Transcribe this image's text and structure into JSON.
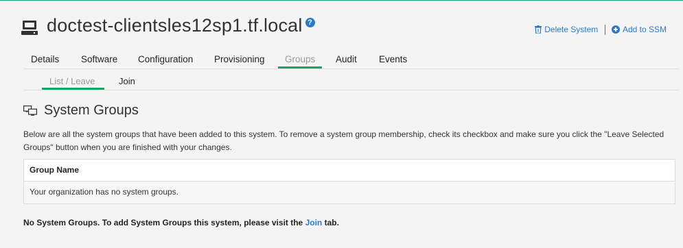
{
  "system": {
    "title": "doctest-clientsles12sp1.tf.local",
    "help_icon": "?"
  },
  "actions": {
    "delete_label": "Delete System",
    "add_ssm_label": "Add to SSM"
  },
  "tabs": [
    {
      "label": "Details",
      "active": false
    },
    {
      "label": "Software",
      "active": false
    },
    {
      "label": "Configuration",
      "active": false
    },
    {
      "label": "Provisioning",
      "active": false
    },
    {
      "label": "Groups",
      "active": true
    },
    {
      "label": "Audit",
      "active": false
    },
    {
      "label": "Events",
      "active": false
    }
  ],
  "subtabs": [
    {
      "label": "List / Leave",
      "active": true
    },
    {
      "label": "Join",
      "active": false
    }
  ],
  "section": {
    "title": "System Groups",
    "description": "Below are all the system groups that have been added to this system. To remove a system group membership, check its checkbox and make sure you click the \"Leave Selected Groups\" button when you are finished with your changes."
  },
  "table": {
    "header": "Group Name",
    "empty_message": "Your organization has no system groups."
  },
  "note": {
    "prefix": "No System Groups. To add System Groups this system, please visit the ",
    "link": "Join",
    "suffix": " tab."
  },
  "colors": {
    "accent": "#18a36d",
    "link": "#2c7ac2",
    "background": "#f4f4f4"
  },
  "icons": {
    "system": "desktop-icon",
    "help": "question-circle-icon",
    "delete": "trash-icon",
    "add": "plus-circle-icon",
    "section": "desktops-icon"
  }
}
